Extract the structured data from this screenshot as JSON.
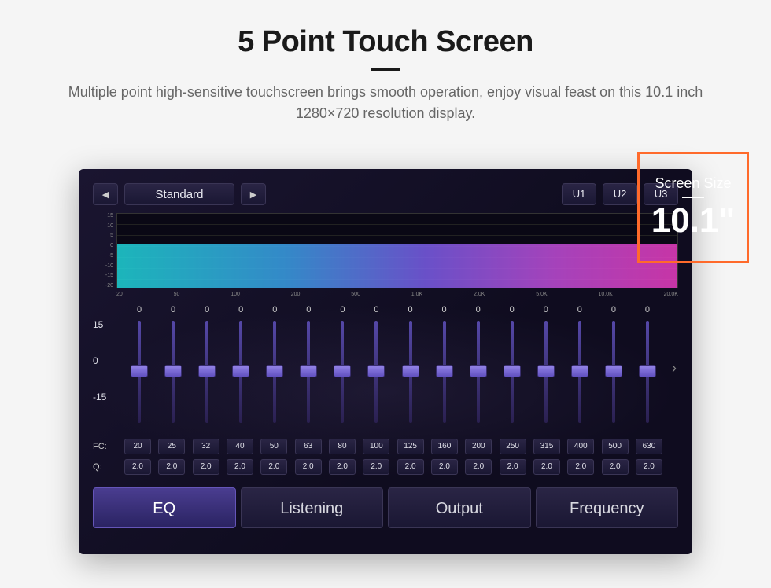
{
  "header": {
    "title": "5 Point Touch Screen",
    "subtitle": "Multiple point high-sensitive touchscreen brings smooth operation, enjoy visual feast on this 10.1 inch 1280×720 resolution display."
  },
  "badge": {
    "label": "Screen Size",
    "value": "10.1\""
  },
  "eq": {
    "preset": "Standard",
    "user_presets": [
      "U1",
      "U2",
      "U3"
    ],
    "y_ticks": [
      "15",
      "10",
      "5",
      "0",
      "-5",
      "-10",
      "-15",
      "-20"
    ],
    "x_ticks": [
      "20",
      "50",
      "100",
      "200",
      "500",
      "1.0K",
      "2.0K",
      "5.0K",
      "10.0K",
      "20.0K"
    ],
    "scale": {
      "max": "15",
      "mid": "0",
      "min": "-15"
    },
    "gains": [
      "0",
      "0",
      "0",
      "0",
      "0",
      "0",
      "0",
      "0",
      "0",
      "0",
      "0",
      "0",
      "0",
      "0",
      "0",
      "0"
    ],
    "fc_label": "FC:",
    "q_label": "Q:",
    "fc": [
      "20",
      "25",
      "32",
      "40",
      "50",
      "63",
      "80",
      "100",
      "125",
      "160",
      "200",
      "250",
      "315",
      "400",
      "500",
      "630"
    ],
    "q": [
      "2.0",
      "2.0",
      "2.0",
      "2.0",
      "2.0",
      "2.0",
      "2.0",
      "2.0",
      "2.0",
      "2.0",
      "2.0",
      "2.0",
      "2.0",
      "2.0",
      "2.0",
      "2.0"
    ],
    "tabs": [
      "EQ",
      "Listening",
      "Output",
      "Frequency"
    ],
    "active_tab": 0
  }
}
